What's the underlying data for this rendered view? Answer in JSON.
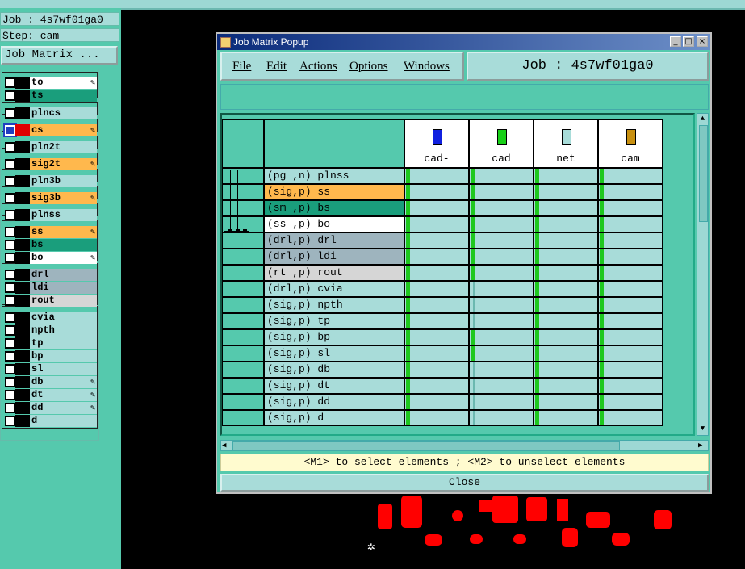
{
  "left_panel": {
    "job_line": "Job : 4s7wf01ga0",
    "step_line": "Step: cam",
    "job_matrix_button": "Job Matrix ...",
    "layers": [
      {
        "name": "to",
        "color": "#ffffff",
        "edit": true
      },
      {
        "name": "ts",
        "color": "#1a9e7c",
        "edit": false
      },
      {
        "name": "plncs",
        "color": "#a8dcd9",
        "edit": false
      },
      {
        "name": "cs",
        "color": "#ffb84d",
        "edit": true,
        "selected": true
      },
      {
        "name": "pln2t",
        "color": "#a8dcd9",
        "edit": false
      },
      {
        "name": "sig2t",
        "color": "#ffb84d",
        "edit": true
      },
      {
        "name": "pln3b",
        "color": "#a8dcd9",
        "edit": false
      },
      {
        "name": "sig3b",
        "color": "#ffb84d",
        "edit": true
      },
      {
        "name": "plnss",
        "color": "#a8dcd9",
        "edit": false
      },
      {
        "name": "ss",
        "color": "#ffb84d",
        "edit": true
      },
      {
        "name": "bs",
        "color": "#1a9e7c",
        "edit": false
      },
      {
        "name": "bo",
        "color": "#ffffff",
        "edit": true
      },
      {
        "name": "drl",
        "color": "#9eb4be",
        "edit": false
      },
      {
        "name": "ldi",
        "color": "#9eb4be",
        "edit": false
      },
      {
        "name": "rout",
        "color": "#d6d6d6",
        "edit": false
      },
      {
        "name": "cvia",
        "color": "#a8dcd9",
        "edit": false
      },
      {
        "name": "npth",
        "color": "#a8dcd9",
        "edit": false
      },
      {
        "name": "tp",
        "color": "#a8dcd9",
        "edit": false
      },
      {
        "name": "bp",
        "color": "#a8dcd9",
        "edit": false
      },
      {
        "name": "sl",
        "color": "#a8dcd9",
        "edit": false
      },
      {
        "name": "db",
        "color": "#a8dcd9",
        "edit": true
      },
      {
        "name": "dt",
        "color": "#a8dcd9",
        "edit": true
      },
      {
        "name": "dd",
        "color": "#a8dcd9",
        "edit": true
      },
      {
        "name": "d",
        "color": "#a8dcd9",
        "edit": false
      }
    ]
  },
  "popup": {
    "title": "Job Matrix Popup",
    "menus": [
      "File",
      "Edit",
      "Actions",
      "Options",
      "Windows"
    ],
    "job_label": "Job : 4s7wf01ga0",
    "hint": "<M1> to select elements ; <M2> to unselect elements",
    "close_label": "Close",
    "columns": [
      {
        "name": "cad-",
        "icon_color": "#1020e0"
      },
      {
        "name": "cad",
        "icon_color": "#18d018"
      },
      {
        "name": "net",
        "icon_color": "#a8dcd9"
      },
      {
        "name": "cam",
        "icon_color": "#c89010"
      }
    ],
    "rows": [
      {
        "label": "(pg ,n) plnss",
        "color": "#a8dcd9",
        "cells": [
          1,
          1,
          1,
          1
        ]
      },
      {
        "label": "(sig,p) ss",
        "color": "#ffb84d",
        "cells": [
          1,
          1,
          1,
          1
        ]
      },
      {
        "label": "(sm ,p) bs",
        "color": "#1a9e7c",
        "cells": [
          1,
          1,
          1,
          1
        ]
      },
      {
        "label": "(ss ,p) bo",
        "color": "#ffffff",
        "cells": [
          1,
          1,
          1,
          1
        ]
      },
      {
        "label": "(drl,p) drl",
        "color": "#9eb4be",
        "cells": [
          1,
          1,
          1,
          1
        ]
      },
      {
        "label": "(drl,p) ldi",
        "color": "#9eb4be",
        "cells": [
          1,
          1,
          1,
          1
        ]
      },
      {
        "label": "(rt ,p) rout",
        "color": "#d6d6d6",
        "cells": [
          1,
          1,
          1,
          1
        ]
      },
      {
        "label": "(drl,p) cvia",
        "color": "#a8dcd9",
        "cells": [
          1,
          0,
          1,
          1
        ]
      },
      {
        "label": "(sig,p) npth",
        "color": "#a8dcd9",
        "cells": [
          1,
          0,
          1,
          1
        ]
      },
      {
        "label": "(sig,p) tp",
        "color": "#a8dcd9",
        "cells": [
          1,
          0,
          1,
          1
        ]
      },
      {
        "label": "(sig,p) bp",
        "color": "#a8dcd9",
        "cells": [
          1,
          1,
          1,
          1
        ]
      },
      {
        "label": "(sig,p) sl",
        "color": "#a8dcd9",
        "cells": [
          1,
          1,
          1,
          1
        ]
      },
      {
        "label": "(sig,p) db",
        "color": "#a8dcd9",
        "cells": [
          1,
          0,
          1,
          1
        ]
      },
      {
        "label": "(sig,p) dt",
        "color": "#a8dcd9",
        "cells": [
          1,
          0,
          1,
          1
        ]
      },
      {
        "label": "(sig,p) dd",
        "color": "#a8dcd9",
        "cells": [
          1,
          0,
          1,
          1
        ]
      },
      {
        "label": "(sig,p) d",
        "color": "#a8dcd9",
        "cells": [
          1,
          0,
          1,
          1
        ]
      }
    ]
  }
}
